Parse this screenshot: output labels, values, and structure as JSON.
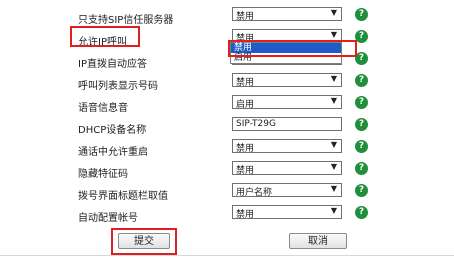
{
  "settings": [
    {
      "label": "只支持SIP信任服务器",
      "control": "select",
      "value": "禁用"
    },
    {
      "label": "允许IP呼叫",
      "control": "select",
      "value": "禁用"
    },
    {
      "label": "IP直拨自动应答",
      "control": "select",
      "value": "启用"
    },
    {
      "label": "呼叫列表显示号码",
      "control": "select",
      "value": "禁用"
    },
    {
      "label": "语音信息音",
      "control": "select",
      "value": "启用"
    },
    {
      "label": "DHCP设备名称",
      "control": "text",
      "value": "SIP-T29G"
    },
    {
      "label": "通话中允许重启",
      "control": "select",
      "value": "禁用"
    },
    {
      "label": "隐藏特征码",
      "control": "select",
      "value": "禁用"
    },
    {
      "label": "拨号界面标题栏取值",
      "control": "select",
      "value": "用户名称"
    },
    {
      "label": "自动配置帐号",
      "control": "select",
      "value": "禁用"
    }
  ],
  "dropdown_open": {
    "options": [
      "禁用",
      "启用"
    ],
    "highlighted": "禁用"
  },
  "help_glyph": "?",
  "arrow_glyph": "▼",
  "buttons": {
    "submit": "提交",
    "cancel": "取消"
  },
  "colors": {
    "highlight_box": "#e02020",
    "help_icon": "#1f8f3a",
    "dropdown_selected": "#1e5dc8"
  }
}
